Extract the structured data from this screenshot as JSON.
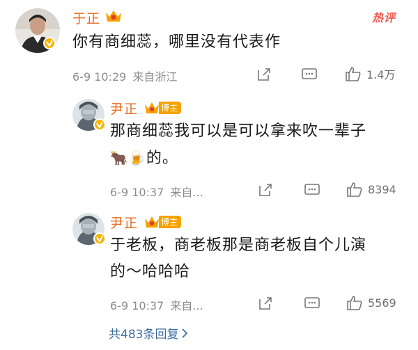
{
  "hot_label": "热评",
  "comments": [
    {
      "name": "于正",
      "content": "你有商细蕊，哪里没有代表作",
      "date": "6-9 10:29",
      "source": "来自浙江",
      "likes": "1.4万"
    },
    {
      "name": "尹正",
      "badge": "博主",
      "content_line1": "那商细蕊我可以是可以拿来吹一辈子",
      "emoji": "🐂🍺",
      "content_line2": "的。",
      "date": "6-9 10:37",
      "source": "来自...",
      "likes": "8394"
    },
    {
      "name": "尹正",
      "badge": "博主",
      "content_line1": "于老板，商老板那是商老板自个儿演",
      "content_line2": "的～哈哈哈",
      "date": "6-9 10:37",
      "source": "来自...",
      "likes": "5569"
    }
  ],
  "more_replies": "共483条回复",
  "colors": {
    "name": "#e86a1f",
    "link": "#3c6e9f",
    "hot": "#f25b4e",
    "badge": "#f5a300"
  }
}
